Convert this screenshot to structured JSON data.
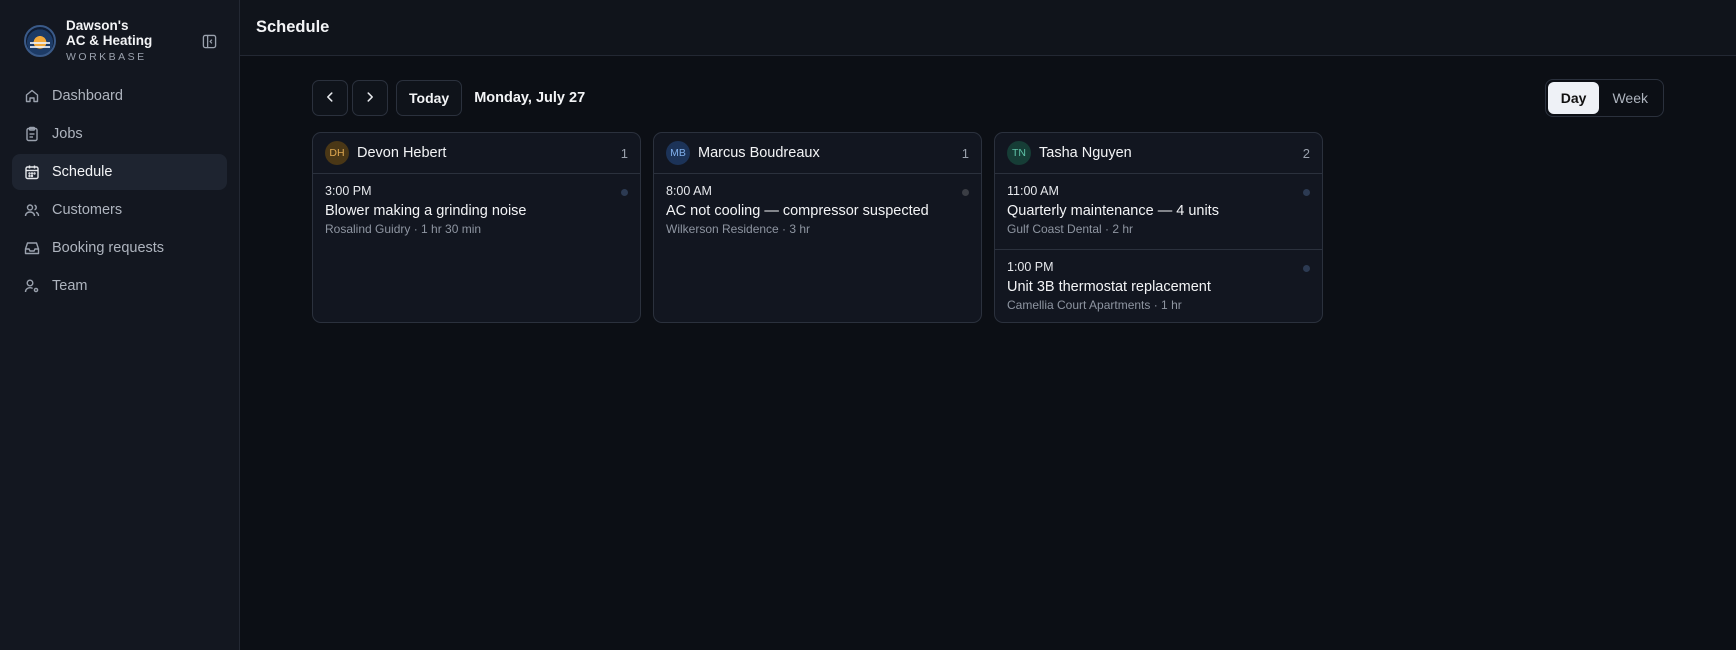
{
  "brand": {
    "name_line1": "Dawson's",
    "name_line2": "AC & Heating",
    "sub": "WORKBASE"
  },
  "sidebar": {
    "items": [
      {
        "label": "Dashboard",
        "icon": "home-icon"
      },
      {
        "label": "Jobs",
        "icon": "clipboard-icon"
      },
      {
        "label": "Schedule",
        "icon": "calendar-icon",
        "active": true
      },
      {
        "label": "Customers",
        "icon": "users-icon"
      },
      {
        "label": "Booking requests",
        "icon": "inbox-icon"
      },
      {
        "label": "Team",
        "icon": "user-cog-icon"
      }
    ]
  },
  "header": {
    "title": "Schedule"
  },
  "toolbar": {
    "today_label": "Today",
    "date_label": "Monday, July 27",
    "views": [
      "Day",
      "Week"
    ],
    "active_view": "Day"
  },
  "technicians": [
    {
      "initials": "DH",
      "name": "Devon Hebert",
      "count": "1",
      "jobs": [
        {
          "time": "3:00 PM",
          "title": "Blower making a grinding noise",
          "meta": "Rosalind Guidry · 1 hr 30 min",
          "status_color": "#2c3a52"
        }
      ]
    },
    {
      "initials": "MB",
      "name": "Marcus Boudreaux",
      "count": "1",
      "jobs": [
        {
          "time": "8:00 AM",
          "title": "AC not cooling — compressor suspected",
          "meta": "Wilkerson Residence · 3 hr",
          "status_color": "#3a3d44"
        }
      ]
    },
    {
      "initials": "TN",
      "name": "Tasha Nguyen",
      "count": "2",
      "jobs": [
        {
          "time": "11:00 AM",
          "title": "Quarterly maintenance — 4 units",
          "meta": "Gulf Coast Dental · 2 hr",
          "status_color": "#2c3a52"
        },
        {
          "time": "1:00 PM",
          "title": "Unit 3B thermostat replacement",
          "meta": "Camellia Court Apartments · 1 hr",
          "status_color": "#2c3a52"
        }
      ]
    }
  ],
  "colors": {
    "background": "#0c0f15",
    "sidebar": "#131720",
    "accent_active_view": "#eef1f6"
  }
}
